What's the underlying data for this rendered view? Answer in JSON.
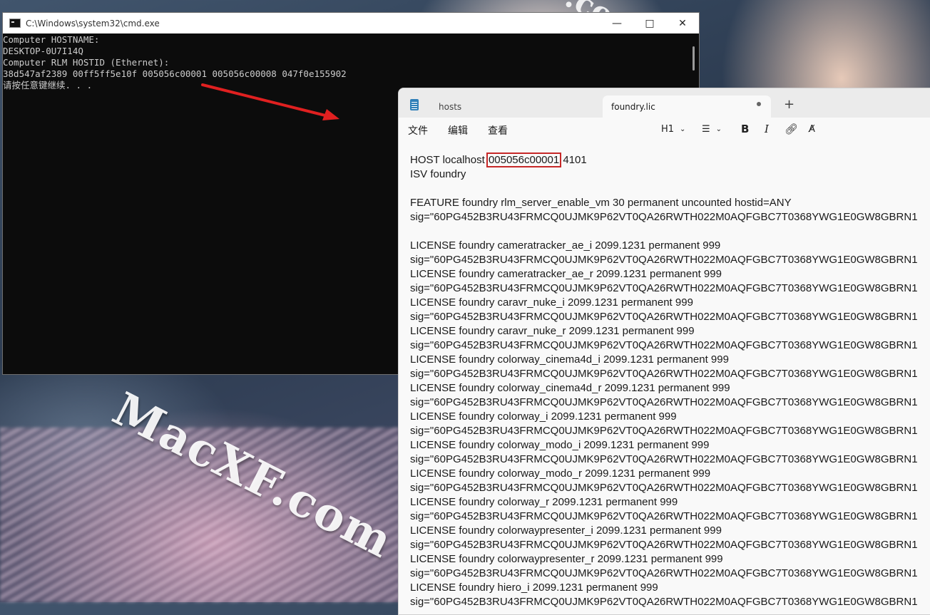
{
  "watermark": "MacXF.com",
  "watermark_top": ".com",
  "cmd": {
    "title": "C:\\Windows\\system32\\cmd.exe",
    "lines": [
      "Computer HOSTNAME:",
      "DESKTOP-0U7I14Q",
      "Computer RLM HOSTID (Ethernet):",
      "38d547af2389 00ff5ff5e10f 005056c00001 005056c00008 047f0e155902",
      "请按任意键继续. . ."
    ]
  },
  "notepad": {
    "tabs": [
      {
        "label": "hosts",
        "active": false
      },
      {
        "label": "foundry.lic",
        "active": true
      }
    ],
    "add_tab": "+",
    "menu": [
      "文件",
      "编辑",
      "查看"
    ],
    "toolbar": {
      "heading": "H1",
      "bold": "B",
      "italic": "I"
    },
    "host_line": {
      "prefix": "HOST localhost ",
      "hostid": "005056c00001",
      "suffix": " 4101"
    },
    "lines": [
      "ISV foundry",
      "",
      "FEATURE foundry rlm_server_enable_vm 30 permanent uncounted hostid=ANY",
      "sig=\"60PG452B3RU43FRMCQ0UJMK9P62VT0QA26RWTH022M0AQFGBC7T0368YWG1E0GW8GBRN1",
      "",
      "LICENSE foundry cameratracker_ae_i 2099.1231 permanent 999",
      "sig=\"60PG452B3RU43FRMCQ0UJMK9P62VT0QA26RWTH022M0AQFGBC7T0368YWG1E0GW8GBRN1",
      "LICENSE foundry cameratracker_ae_r 2099.1231 permanent 999",
      "sig=\"60PG452B3RU43FRMCQ0UJMK9P62VT0QA26RWTH022M0AQFGBC7T0368YWG1E0GW8GBRN1",
      "LICENSE foundry caravr_nuke_i 2099.1231 permanent 999",
      "sig=\"60PG452B3RU43FRMCQ0UJMK9P62VT0QA26RWTH022M0AQFGBC7T0368YWG1E0GW8GBRN1",
      "LICENSE foundry caravr_nuke_r 2099.1231 permanent 999",
      "sig=\"60PG452B3RU43FRMCQ0UJMK9P62VT0QA26RWTH022M0AQFGBC7T0368YWG1E0GW8GBRN1",
      "LICENSE foundry colorway_cinema4d_i 2099.1231 permanent 999",
      "sig=\"60PG452B3RU43FRMCQ0UJMK9P62VT0QA26RWTH022M0AQFGBC7T0368YWG1E0GW8GBRN1",
      "LICENSE foundry colorway_cinema4d_r 2099.1231 permanent 999",
      "sig=\"60PG452B3RU43FRMCQ0UJMK9P62VT0QA26RWTH022M0AQFGBC7T0368YWG1E0GW8GBRN1",
      "LICENSE foundry colorway_i 2099.1231 permanent 999",
      "sig=\"60PG452B3RU43FRMCQ0UJMK9P62VT0QA26RWTH022M0AQFGBC7T0368YWG1E0GW8GBRN1",
      "LICENSE foundry colorway_modo_i 2099.1231 permanent 999",
      "sig=\"60PG452B3RU43FRMCQ0UJMK9P62VT0QA26RWTH022M0AQFGBC7T0368YWG1E0GW8GBRN1",
      "LICENSE foundry colorway_modo_r 2099.1231 permanent 999",
      "sig=\"60PG452B3RU43FRMCQ0UJMK9P62VT0QA26RWTH022M0AQFGBC7T0368YWG1E0GW8GBRN1",
      "LICENSE foundry colorway_r 2099.1231 permanent 999",
      "sig=\"60PG452B3RU43FRMCQ0UJMK9P62VT0QA26RWTH022M0AQFGBC7T0368YWG1E0GW8GBRN1",
      "LICENSE foundry colorwaypresenter_i 2099.1231 permanent 999",
      "sig=\"60PG452B3RU43FRMCQ0UJMK9P62VT0QA26RWTH022M0AQFGBC7T0368YWG1E0GW8GBRN1",
      "LICENSE foundry colorwaypresenter_r 2099.1231 permanent 999",
      "sig=\"60PG452B3RU43FRMCQ0UJMK9P62VT0QA26RWTH022M0AQFGBC7T0368YWG1E0GW8GBRN1",
      "LICENSE foundry hiero_i 2099.1231 permanent 999",
      "sig=\"60PG452B3RU43FRMCQ0UJMK9P62VT0QA26RWTH022M0AQFGBC7T0368YWG1E0GW8GBRN1"
    ]
  },
  "colors": {
    "highlight_box": "#c62828",
    "arrow": "#e02020"
  }
}
